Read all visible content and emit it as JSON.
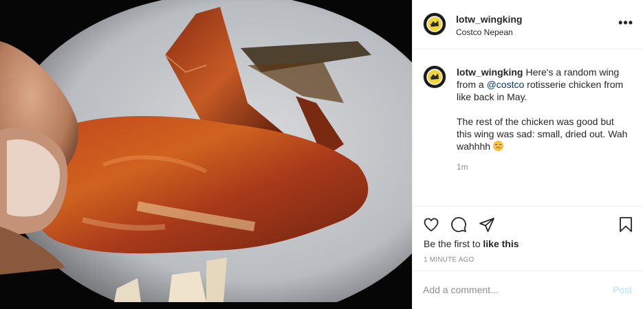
{
  "header": {
    "username": "lotw_wingking",
    "location": "Costco Nepean",
    "more_label": "•••"
  },
  "caption": {
    "username": "lotw_wingking",
    "text_before": "Here's a random wing from a ",
    "mention": "@costco",
    "text_after": " rotisserie chicken from like back in May.",
    "paragraph2": "The rest of the chicken was good but this wing was sad: small, dried out. Wah wahhhh ",
    "emoji": "disappointed-face",
    "age": "1m"
  },
  "actions": {
    "icons": [
      "heart-icon",
      "comment-icon",
      "share-icon",
      "bookmark-icon"
    ],
    "likes_prefix": "Be the first to ",
    "likes_link": "like this",
    "timestamp": "1 MINUTE AGO"
  },
  "add_comment": {
    "placeholder": "Add a comment...",
    "post_label": "Post"
  },
  "colors": {
    "post_button_disabled": "#b2dffc",
    "mention": "#00376b",
    "muted": "#8e8e8e"
  }
}
